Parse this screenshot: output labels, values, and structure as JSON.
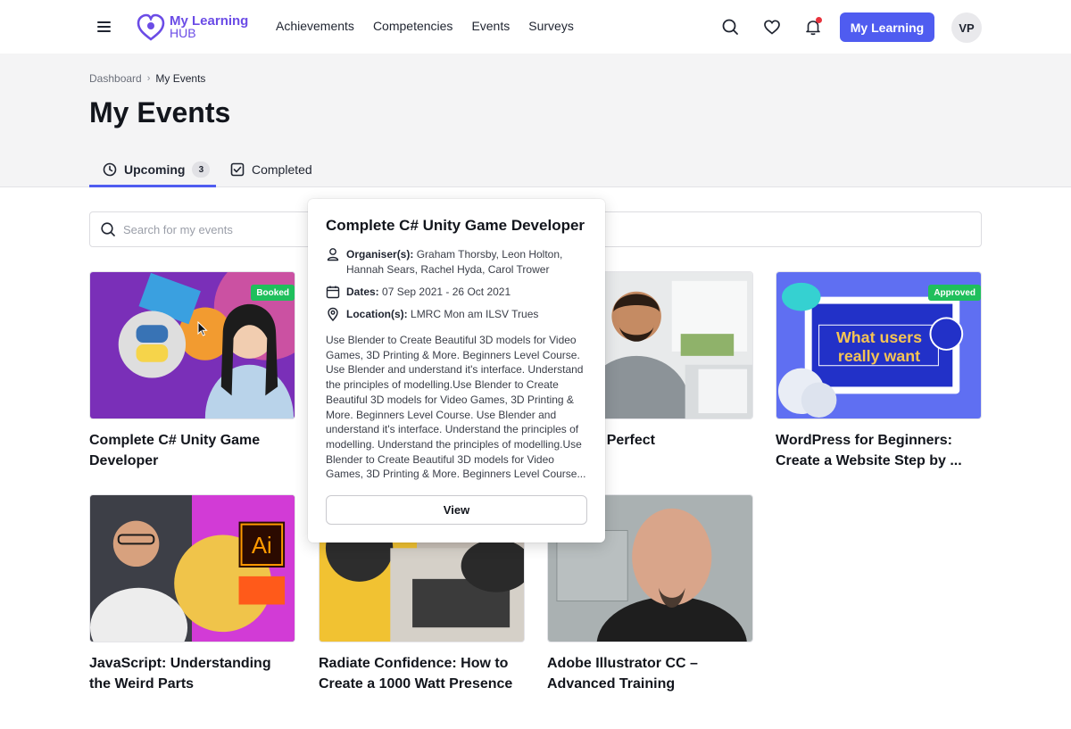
{
  "app": {
    "logo_line1": "My Learning",
    "logo_line2": "HUB",
    "nav": [
      "Achievements",
      "Competencies",
      "Events",
      "Surveys"
    ],
    "my_learning_button": "My Learning",
    "avatar_initials": "VP",
    "accent_color": "#4f5cf0",
    "icons": [
      "menu-icon",
      "search-icon",
      "heart-icon",
      "bell-icon"
    ]
  },
  "breadcrumb": {
    "parent": "Dashboard",
    "current": "My Events"
  },
  "page_title": "My Events",
  "tabs": [
    {
      "label": "Upcoming",
      "count": "3",
      "active": true,
      "icon": "clock-icon"
    },
    {
      "label": "Completed",
      "active": false,
      "icon": "checkbox-icon"
    }
  ],
  "search": {
    "placeholder": "Search for my events"
  },
  "cards": [
    {
      "title": "Complete C# Unity Game Developer",
      "badge": "Booked"
    },
    {
      "title": "",
      "badge": ""
    },
    {
      "title": "ecurity - Perfect\nds",
      "badge": ""
    },
    {
      "title": "WordPress for Beginners: Create a Website Step by ...",
      "badge": "Approved",
      "thumb_text": "What users really want"
    },
    {
      "title": "JavaScript: Understanding the Weird Parts",
      "badge": "",
      "thumb_text": "Ai"
    },
    {
      "title": "Radiate Confidence: How to Create a 1000 Watt Presence",
      "badge": ""
    },
    {
      "title": "Adobe Illustrator CC – Advanced Training",
      "badge": ""
    }
  ],
  "popover": {
    "title": "Complete C# Unity Game Developer",
    "organisers_label": "Organiser(s):",
    "organisers": "Graham Thorsby, Leon Holton, Hannah Sears, Rachel Hyda, Carol Trower",
    "dates_label": "Dates:",
    "dates": "07 Sep 2021 - 26 Oct 2021",
    "location_label": "Location(s):",
    "location": "LMRC Mon am ILSV Trues",
    "description": "Use Blender to Create Beautiful 3D models for Video Games, 3D Printing & More. Beginners Level Course. Use Blender and understand it's interface. Understand the principles of modelling.Use Blender to Create Beautiful 3D models for Video Games, 3D Printing & More. Beginners Level Course. Use Blender and understand it's interface. Understand the principles of modelling. Understand the principles of modelling.Use Blender to Create Beautiful 3D models for Video Games, 3D Printing & More. Beginners Level Course...",
    "view_button": "View"
  }
}
